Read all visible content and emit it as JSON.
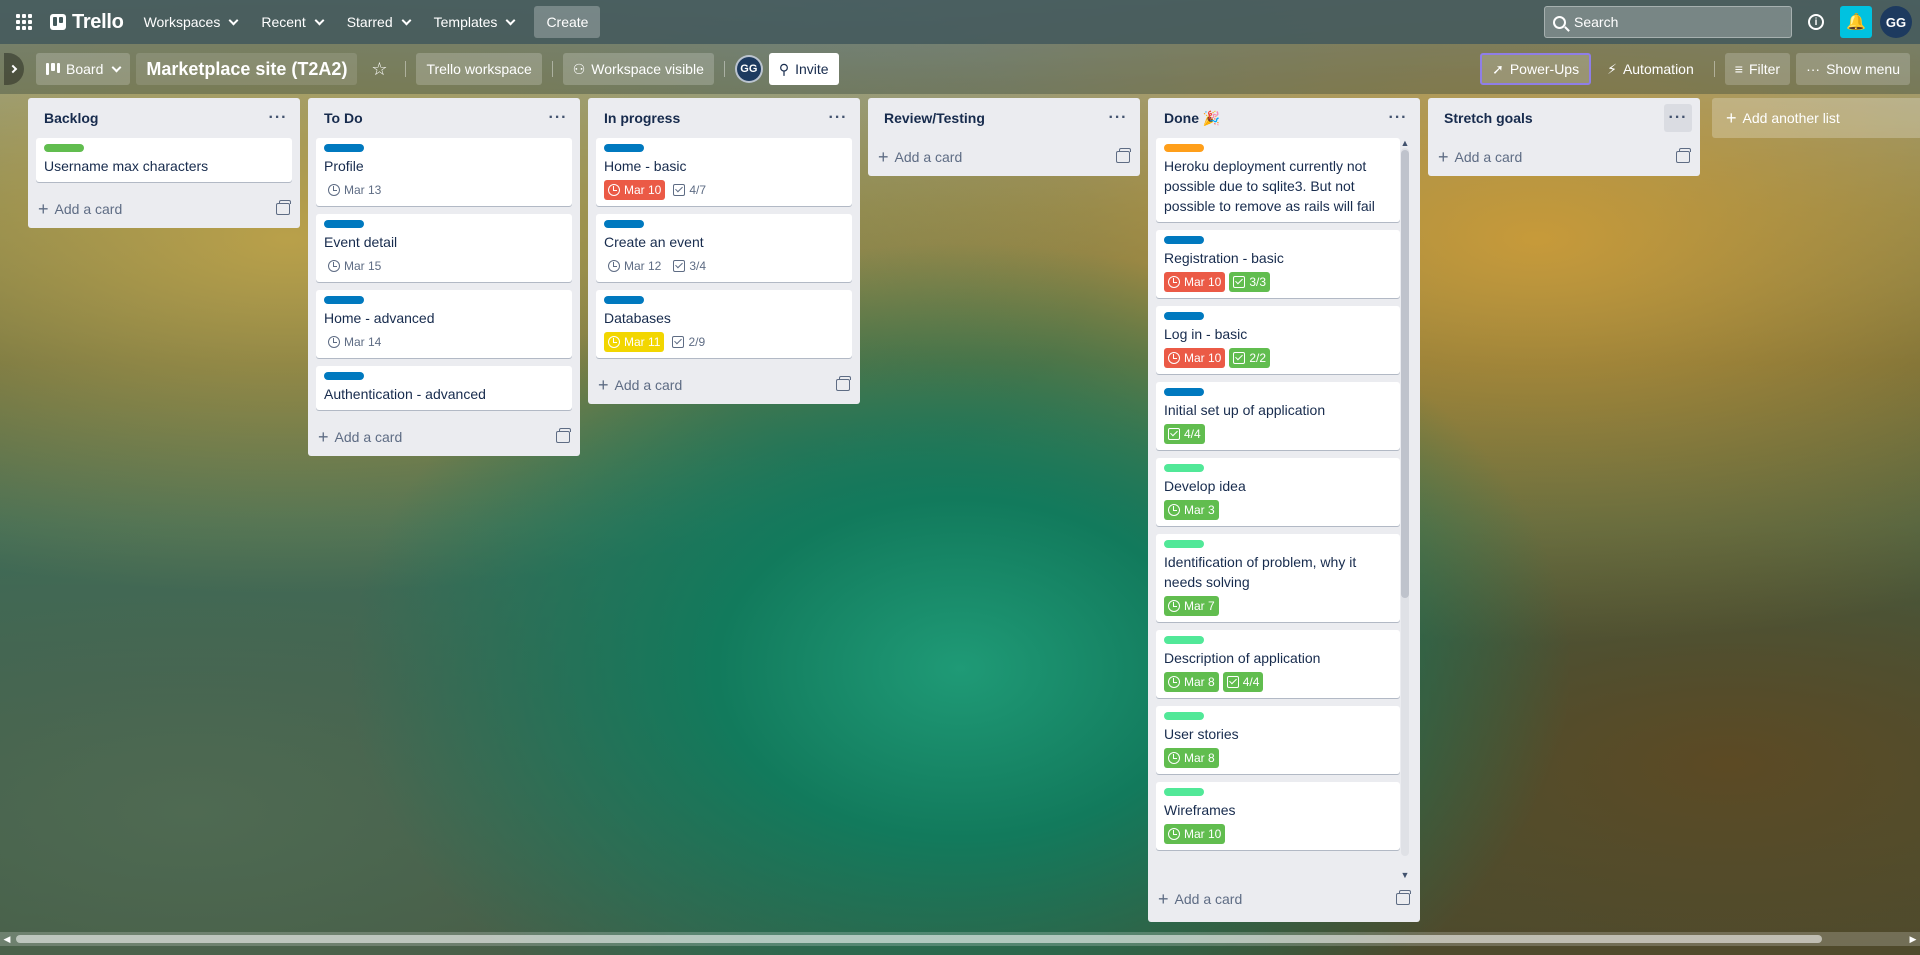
{
  "header": {
    "logo_text": "Trello",
    "nav": [
      {
        "label": "Workspaces"
      },
      {
        "label": "Recent"
      },
      {
        "label": "Starred"
      },
      {
        "label": "Templates"
      }
    ],
    "create_label": "Create",
    "search_placeholder": "Search",
    "avatar_initials": "GG",
    "accent_color": "#00c2e0"
  },
  "board_header": {
    "view_label": "Board",
    "title": "Marketplace site (T2A2)",
    "workspace_label": "Trello workspace",
    "visibility_label": "Workspace visible",
    "member_initials": "GG",
    "invite_label": "Invite",
    "powerups_label": "Power-Ups",
    "automation_label": "Automation",
    "filter_label": "Filter",
    "show_menu_label": "Show menu"
  },
  "lists": [
    {
      "title": "Backlog",
      "cards": [
        {
          "label_color": "#61bd4f",
          "title": "Username max characters",
          "badges": []
        }
      ],
      "add_card_label": "Add a card"
    },
    {
      "title": "To Do",
      "cards": [
        {
          "label_color": "#0079bf",
          "title": "Profile",
          "badges": [
            {
              "type": "date",
              "text": "Mar 13",
              "style": "plain"
            }
          ]
        },
        {
          "label_color": "#0079bf",
          "title": "Event detail",
          "badges": [
            {
              "type": "date",
              "text": "Mar 15",
              "style": "plain"
            }
          ]
        },
        {
          "label_color": "#0079bf",
          "title": "Home - advanced",
          "badges": [
            {
              "type": "date",
              "text": "Mar 14",
              "style": "plain"
            }
          ]
        },
        {
          "label_color": "#0079bf",
          "title": "Authentication - advanced",
          "badges": []
        }
      ],
      "add_card_label": "Add a card"
    },
    {
      "title": "In progress",
      "cards": [
        {
          "label_color": "#0079bf",
          "title": "Home - basic",
          "badges": [
            {
              "type": "date",
              "text": "Mar 10",
              "style": "red"
            },
            {
              "type": "check",
              "text": "4/7",
              "style": "plain"
            }
          ]
        },
        {
          "label_color": "#0079bf",
          "title": "Create an event",
          "badges": [
            {
              "type": "date",
              "text": "Mar 12",
              "style": "plain"
            },
            {
              "type": "check",
              "text": "3/4",
              "style": "plain"
            }
          ]
        },
        {
          "label_color": "#0079bf",
          "title": "Databases",
          "badges": [
            {
              "type": "date",
              "text": "Mar 11",
              "style": "yellow"
            },
            {
              "type": "check",
              "text": "2/9",
              "style": "plain"
            }
          ]
        }
      ],
      "add_card_label": "Add a card"
    },
    {
      "title": "Review/Testing",
      "cards": [],
      "add_card_label": "Add a card"
    },
    {
      "title": "Done 🎉",
      "cards": [
        {
          "label_color": "#ff9f1a",
          "title": "Heroku deployment currently not possible due to sqlite3. But not possible to remove as rails will fail",
          "badges": []
        },
        {
          "label_color": "#0079bf",
          "title": "Registration - basic",
          "badges": [
            {
              "type": "date",
              "text": "Mar 10",
              "style": "red"
            },
            {
              "type": "check",
              "text": "3/3",
              "style": "green"
            }
          ]
        },
        {
          "label_color": "#0079bf",
          "title": "Log in - basic",
          "badges": [
            {
              "type": "date",
              "text": "Mar 10",
              "style": "red"
            },
            {
              "type": "check",
              "text": "2/2",
              "style": "green"
            }
          ]
        },
        {
          "label_color": "#0079bf",
          "title": "Initial set up of application",
          "badges": [
            {
              "type": "check",
              "text": "4/4",
              "style": "green"
            }
          ]
        },
        {
          "label_color": "#51e898",
          "title": "Develop idea",
          "badges": [
            {
              "type": "date",
              "text": "Mar 3",
              "style": "green"
            }
          ]
        },
        {
          "label_color": "#51e898",
          "title": "Identification of problem, why it needs solving",
          "badges": [
            {
              "type": "date",
              "text": "Mar 7",
              "style": "green"
            }
          ]
        },
        {
          "label_color": "#51e898",
          "title": "Description of application",
          "badges": [
            {
              "type": "date",
              "text": "Mar 8",
              "style": "green"
            },
            {
              "type": "check",
              "text": "4/4",
              "style": "green"
            }
          ]
        },
        {
          "label_color": "#51e898",
          "title": "User stories",
          "badges": [
            {
              "type": "date",
              "text": "Mar 8",
              "style": "green"
            }
          ]
        },
        {
          "label_color": "#51e898",
          "title": "Wireframes",
          "badges": [
            {
              "type": "date",
              "text": "Mar 10",
              "style": "green"
            }
          ]
        }
      ],
      "add_card_label": "Add a card"
    },
    {
      "title": "Stretch goals",
      "cards": [],
      "add_card_label": "Add a card"
    }
  ],
  "add_list_label": "Add another list"
}
